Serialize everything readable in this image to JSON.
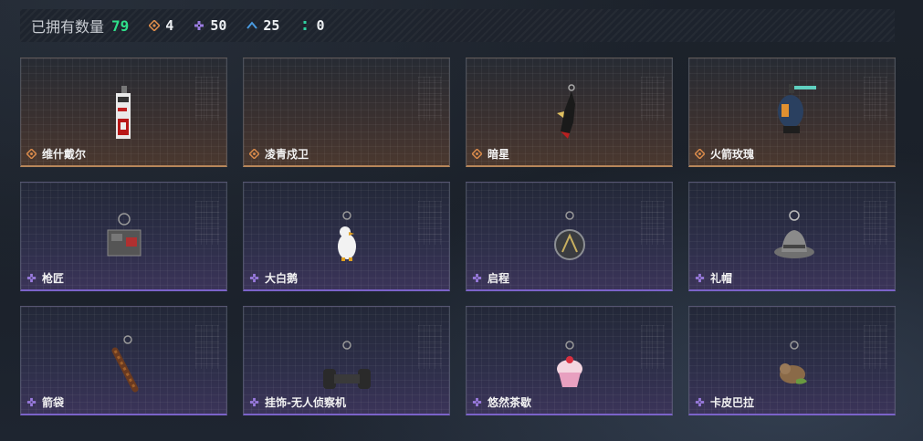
{
  "header": {
    "owned_label": "已拥有数量",
    "owned_count": "79",
    "stats": [
      {
        "icon": "orange-diamond-icon",
        "color": "#d98a4a",
        "value": "4"
      },
      {
        "icon": "purple-diamond-icon",
        "color": "#9a7be0",
        "value": "50"
      },
      {
        "icon": "blue-chevron-icon",
        "color": "#4a9be0",
        "value": "25"
      },
      {
        "icon": "green-dots-icon",
        "color": "#2fd0a0",
        "value": "0"
      }
    ]
  },
  "colors": {
    "orange_rarity": "#d98a4a",
    "purple_rarity": "#9a7be0",
    "owned_count": "#2fe08a"
  },
  "items": [
    {
      "name": "维什戴尔",
      "rarity": "orange",
      "art": "tag-charm"
    },
    {
      "name": "凌青戍卫",
      "rarity": "orange",
      "art": "none"
    },
    {
      "name": "暗星",
      "rarity": "orange",
      "art": "feather-charm"
    },
    {
      "name": "火箭玫瑰",
      "rarity": "orange",
      "art": "rocket-charm"
    },
    {
      "name": "枪匠",
      "rarity": "purple",
      "art": "chest-charm"
    },
    {
      "name": "大白鹅",
      "rarity": "purple",
      "art": "goose-charm"
    },
    {
      "name": "启程",
      "rarity": "purple",
      "art": "medal-charm"
    },
    {
      "name": "礼帽",
      "rarity": "purple",
      "art": "hat-charm"
    },
    {
      "name": "箭袋",
      "rarity": "purple",
      "art": "quiver-charm"
    },
    {
      "name": "挂饰-无人侦察机",
      "rarity": "purple",
      "art": "drone-charm"
    },
    {
      "name": "悠然茶歇",
      "rarity": "purple",
      "art": "cupcake-charm"
    },
    {
      "name": "卡皮巴拉",
      "rarity": "purple",
      "art": "capybara-charm"
    }
  ]
}
